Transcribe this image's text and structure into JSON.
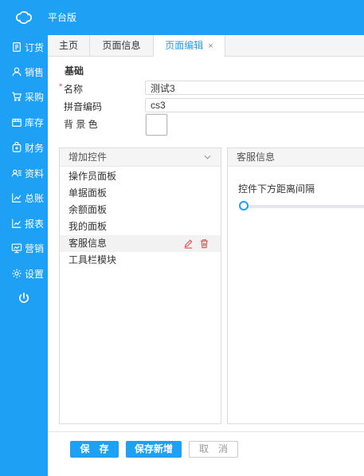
{
  "app": {
    "brand": "平台版",
    "logo_icon": "cloud-link-icon",
    "accent_color": "#1ea0f5"
  },
  "sidebar": {
    "items": [
      {
        "label": "订货",
        "icon": "order-doc-icon"
      },
      {
        "label": "销售",
        "icon": "user-icon"
      },
      {
        "label": "采购",
        "icon": "cart-icon"
      },
      {
        "label": "库存",
        "icon": "warehouse-icon"
      },
      {
        "label": "财务",
        "icon": "wallet-icon"
      },
      {
        "label": "资料",
        "icon": "contacts-icon"
      },
      {
        "label": "总账",
        "icon": "chart-icon"
      },
      {
        "label": "报表",
        "icon": "report-icon"
      },
      {
        "label": "营销",
        "icon": "monitor-icon"
      },
      {
        "label": "设置",
        "icon": "gear-icon"
      }
    ],
    "power_icon": "power-icon"
  },
  "tabs": [
    {
      "label": "主页",
      "active": false
    },
    {
      "label": "页面信息",
      "active": false
    },
    {
      "label": "页面编辑",
      "active": true,
      "close": "×"
    }
  ],
  "form": {
    "section_title": "基础",
    "required_mark": "*",
    "name_label": "名称",
    "name_value": "测试3",
    "pinyin_label": "拼音编码",
    "pinyin_value": "cs3",
    "bg_label": "背 景 色",
    "bg_color": "#ffffff"
  },
  "controls_panel": {
    "title": "增加控件",
    "items": [
      "操作员面板",
      "单据面板",
      "余额面板",
      "我的面板",
      "客服信息",
      "工具栏模块"
    ],
    "hover_index": 4,
    "edit_color": "#e84d4d"
  },
  "detail_panel": {
    "title": "客服信息",
    "field_label": "控件下方距离间隔",
    "slider_value": 0
  },
  "footer": {
    "save": "保　存",
    "save_new": "保存新增",
    "cancel": "取　消"
  }
}
